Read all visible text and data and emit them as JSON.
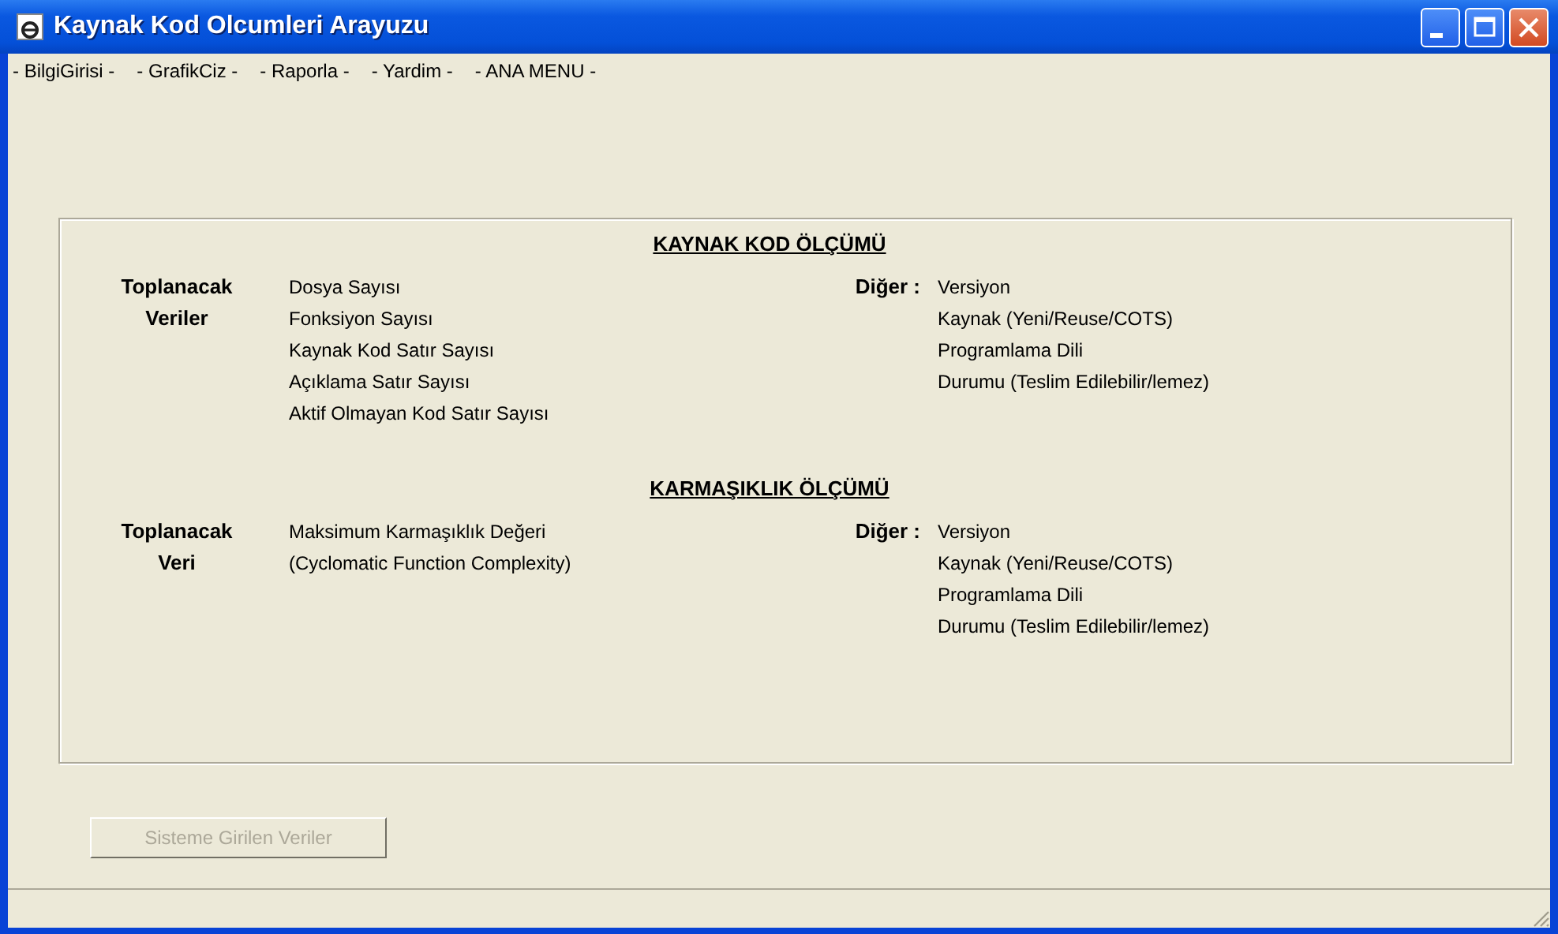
{
  "window": {
    "title": "Kaynak Kod Olcumleri Arayuzu"
  },
  "menu": [
    "- BilgiGirisi -",
    "- GrafikCiz -",
    "- Raporla -",
    "- Yardim -",
    "- ANA MENU -"
  ],
  "sections": [
    {
      "heading": "KAYNAK KOD ÖLÇÜMÜ",
      "label_lines": [
        "Toplanacak",
        "Veriler"
      ],
      "items": [
        "Dosya Sayısı",
        "Fonksiyon Sayısı",
        "Kaynak Kod Satır Sayısı",
        "Açıklama Satır Sayısı",
        "Aktif Olmayan Kod Satır Sayısı"
      ],
      "other_label": "Diğer :",
      "other_items": [
        "Versiyon",
        "Kaynak (Yeni/Reuse/COTS)",
        "Programlama Dili",
        "Durumu (Teslim Edilebilir/lemez)"
      ]
    },
    {
      "heading": "KARMAŞIKLIK ÖLÇÜMÜ",
      "label_lines": [
        "Toplanacak",
        "Veri"
      ],
      "items": [
        "Maksimum Karmaşıklık Değeri",
        "(Cyclomatic Function Complexity)"
      ],
      "other_label": "Diğer :",
      "other_items": [
        "Versiyon",
        "Kaynak (Yeni/Reuse/COTS)",
        "Programlama Dili",
        "Durumu (Teslim Edilebilir/lemez)"
      ]
    }
  ],
  "button": {
    "label": "Sisteme Girilen Veriler",
    "disabled": true
  }
}
